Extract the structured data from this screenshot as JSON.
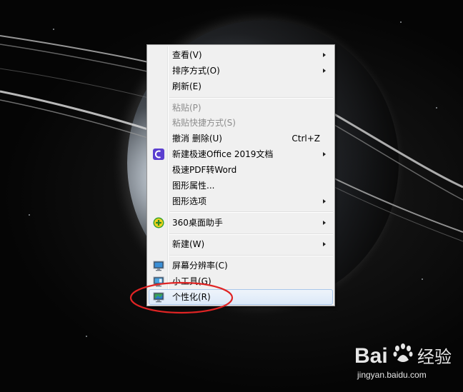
{
  "context_menu": {
    "items": [
      {
        "label": "查看(V)",
        "submenu": true
      },
      {
        "label": "排序方式(O)",
        "submenu": true
      },
      {
        "label": "刷新(E)"
      },
      {
        "label": "粘贴(P)",
        "disabled": true
      },
      {
        "label": "粘贴快捷方式(S)",
        "disabled": true
      },
      {
        "label": "撤消 删除(U)",
        "shortcut": "Ctrl+Z"
      },
      {
        "label": "新建极速Office 2019文档",
        "submenu": true,
        "icon": "jisu-office-icon"
      },
      {
        "label": "极速PDF转Word"
      },
      {
        "label": "图形属性..."
      },
      {
        "label": "图形选项",
        "submenu": true
      },
      {
        "label": "360桌面助手",
        "submenu": true,
        "icon": "360-plus-icon"
      },
      {
        "label": "新建(W)",
        "submenu": true
      },
      {
        "label": "屏幕分辨率(C)",
        "icon": "monitor-icon"
      },
      {
        "label": "小工具(G)",
        "icon": "gadgets-icon"
      },
      {
        "label": "个性化(R)",
        "icon": "personalize-icon",
        "highlighted": true
      }
    ]
  },
  "annotation": {
    "shape": "red-ellipse",
    "color": "#e02424",
    "target": "个性化(R)"
  },
  "watermark": {
    "logo": "Bai 经验",
    "url": "jingyan.baidu.com"
  }
}
